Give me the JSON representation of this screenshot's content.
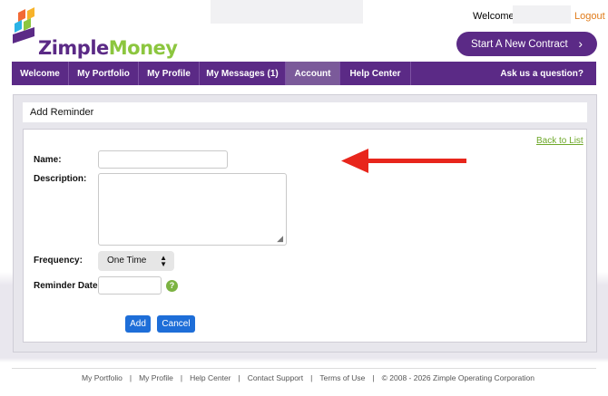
{
  "header": {
    "logo_part1": "Zimple",
    "logo_part2": "Money",
    "welcome": "Welcome,",
    "logout": "Logout",
    "start_contract": "Start A New Contract",
    "start_contract_chevron": "›"
  },
  "nav": {
    "items": [
      {
        "label": "Welcome"
      },
      {
        "label": "My Portfolio"
      },
      {
        "label": "My Profile"
      },
      {
        "label": "My Messages (1)"
      },
      {
        "label": "Account"
      },
      {
        "label": "Help Center"
      }
    ],
    "ask": "Ask us a question?",
    "active": "Account"
  },
  "panel": {
    "title": "Add Reminder",
    "back_link": "Back to List"
  },
  "form": {
    "name_label": "Name:",
    "name_value": "",
    "description_label": "Description:",
    "description_value": "",
    "frequency_label": "Frequency:",
    "frequency_value": "One Time",
    "reminder_date_label": "Reminder Date:",
    "reminder_date_value": "",
    "help_icon": "?",
    "add_button": "Add",
    "cancel_button": "Cancel"
  },
  "footer": {
    "links": [
      "My Portfolio",
      "My Profile",
      "Help Center",
      "Contact Support",
      "Terms of Use"
    ],
    "copyright": "© 2008 - 2026 Zimple Operating Corporation"
  },
  "colors": {
    "brand_purple": "#5b2a86",
    "brand_green": "#8cc63f",
    "button_blue": "#1e6ed8",
    "arrow_red": "#e8261c"
  }
}
